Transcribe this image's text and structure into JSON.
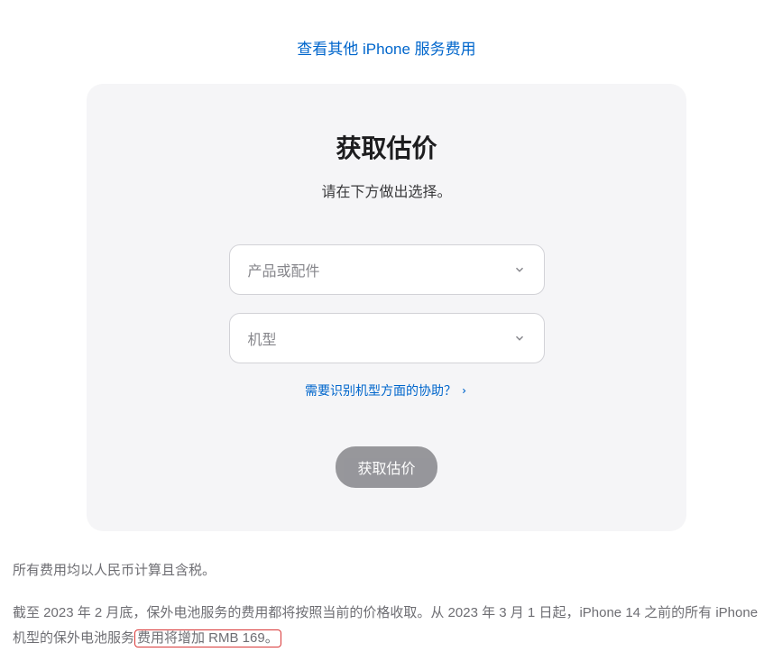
{
  "topLink": {
    "label": "查看其他 iPhone 服务费用"
  },
  "card": {
    "title": "获取估价",
    "subtitle": "请在下方做出选择。",
    "selects": {
      "product": {
        "placeholder": "产品或配件"
      },
      "model": {
        "placeholder": "机型"
      }
    },
    "helpLink": {
      "label": "需要识别机型方面的协助？"
    },
    "submit": {
      "label": "获取估价"
    }
  },
  "footer": {
    "line1": "所有费用均以人民币计算且含税。",
    "line2_pre": "截至 2023 年 2 月底，保外电池服务的费用都将按照当前的价格收取。从 2023 年 3 月 1 日起，iPhone 14 之前的所有 iPhone 机型的保外电池服务",
    "line2_highlight": "费用将增加 RMB 169。"
  }
}
